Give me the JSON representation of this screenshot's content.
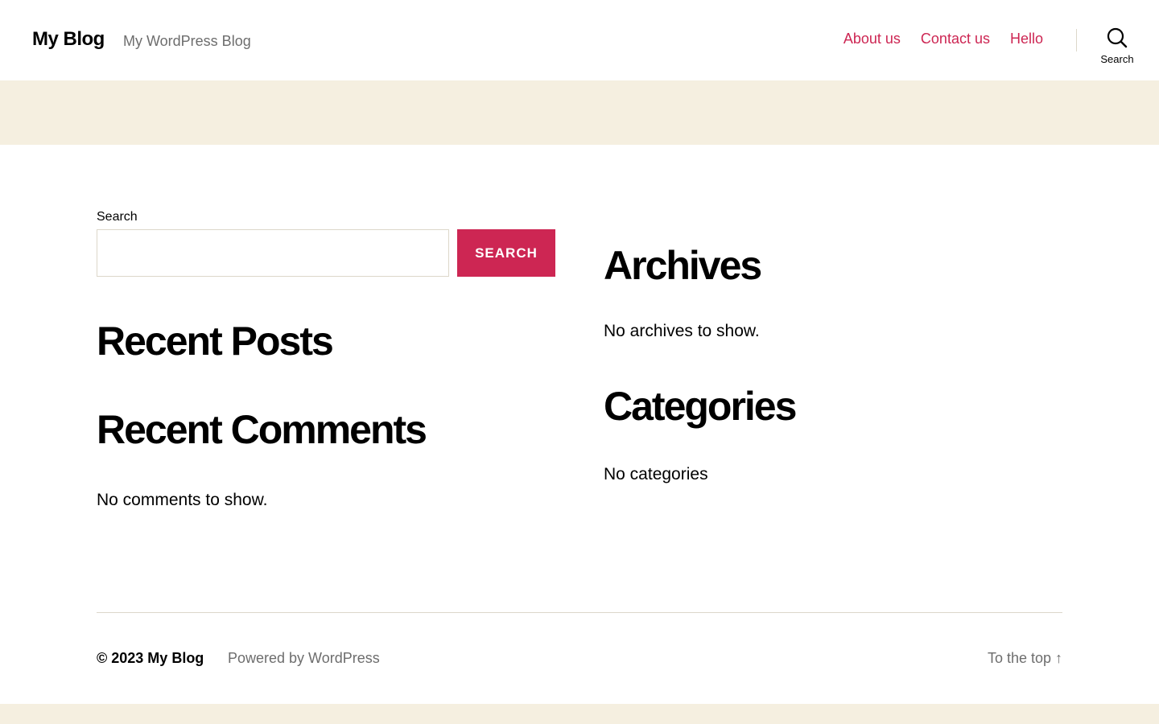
{
  "header": {
    "site_title": "My Blog",
    "site_description": "My WordPress Blog",
    "nav": [
      "About us",
      "Contact us",
      "Hello"
    ],
    "search_toggle_label": "Search"
  },
  "colors": {
    "accent": "#cd2653",
    "band": "#f5efe0",
    "muted_text": "#6d6d6d",
    "border": "#dcd7ca"
  },
  "widgets": {
    "search": {
      "label": "Search",
      "value": "",
      "button_label": "SEARCH"
    },
    "recent_posts": {
      "title": "Recent Posts"
    },
    "recent_comments": {
      "title": "Recent Comments",
      "empty_text": "No comments to show."
    },
    "archives": {
      "title": "Archives",
      "empty_text": "No archives to show."
    },
    "categories": {
      "title": "Categories",
      "empty_text": "No categories"
    }
  },
  "footer": {
    "copyright": "© 2023 My Blog",
    "powered_by": "Powered by WordPress",
    "to_top": "To the top ↑"
  },
  "icons": {
    "search_toggle": "search-icon"
  }
}
